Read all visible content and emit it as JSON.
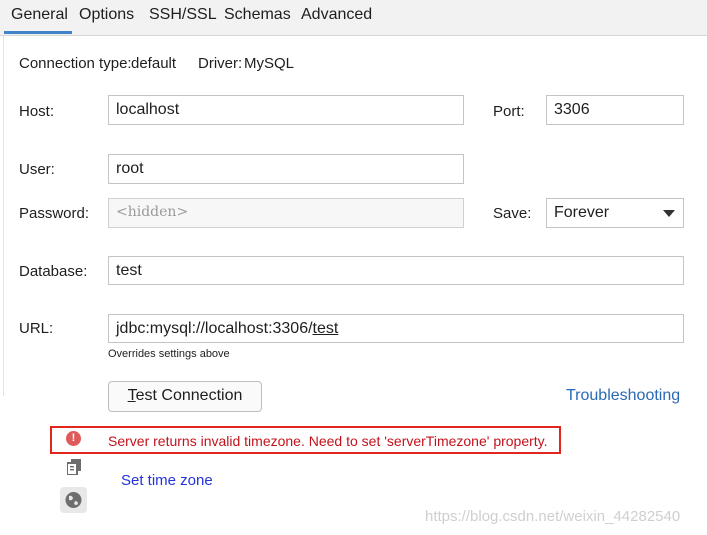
{
  "tabs": [
    "General",
    "Options",
    "SSH/SSL",
    "Schemas",
    "Advanced"
  ],
  "connection": {
    "type_label": "Connection type:",
    "type_value": "default",
    "driver_label": "Driver:",
    "driver_value": "MySQL"
  },
  "form": {
    "host_label": "Host:",
    "host_value": "localhost",
    "port_label": "Port:",
    "port_value": "3306",
    "user_label": "User:",
    "user_value": "root",
    "password_label": "Password:",
    "password_placeholder": "<hidden>",
    "save_label": "Save:",
    "save_value": "Forever",
    "database_label": "Database:",
    "database_value": "test",
    "url_label": "URL:",
    "url_prefix": "jdbc:mysql://localhost:3306/",
    "url_db": "test",
    "url_hint": "Overrides settings above"
  },
  "actions": {
    "test_connection_mnemonic": "T",
    "test_connection_rest": "est Connection",
    "troubleshooting": "Troubleshooting"
  },
  "error": {
    "message": "Server returns invalid timezone. Need to set 'serverTimezone' property.",
    "fix_link": "Set time zone"
  },
  "watermark": "https://blog.csdn.net/weixin_44282540",
  "colors": {
    "accent": "#4083c9",
    "link": "#2a6ab5",
    "error": "#c4121b",
    "error_border": "#e0261e"
  }
}
